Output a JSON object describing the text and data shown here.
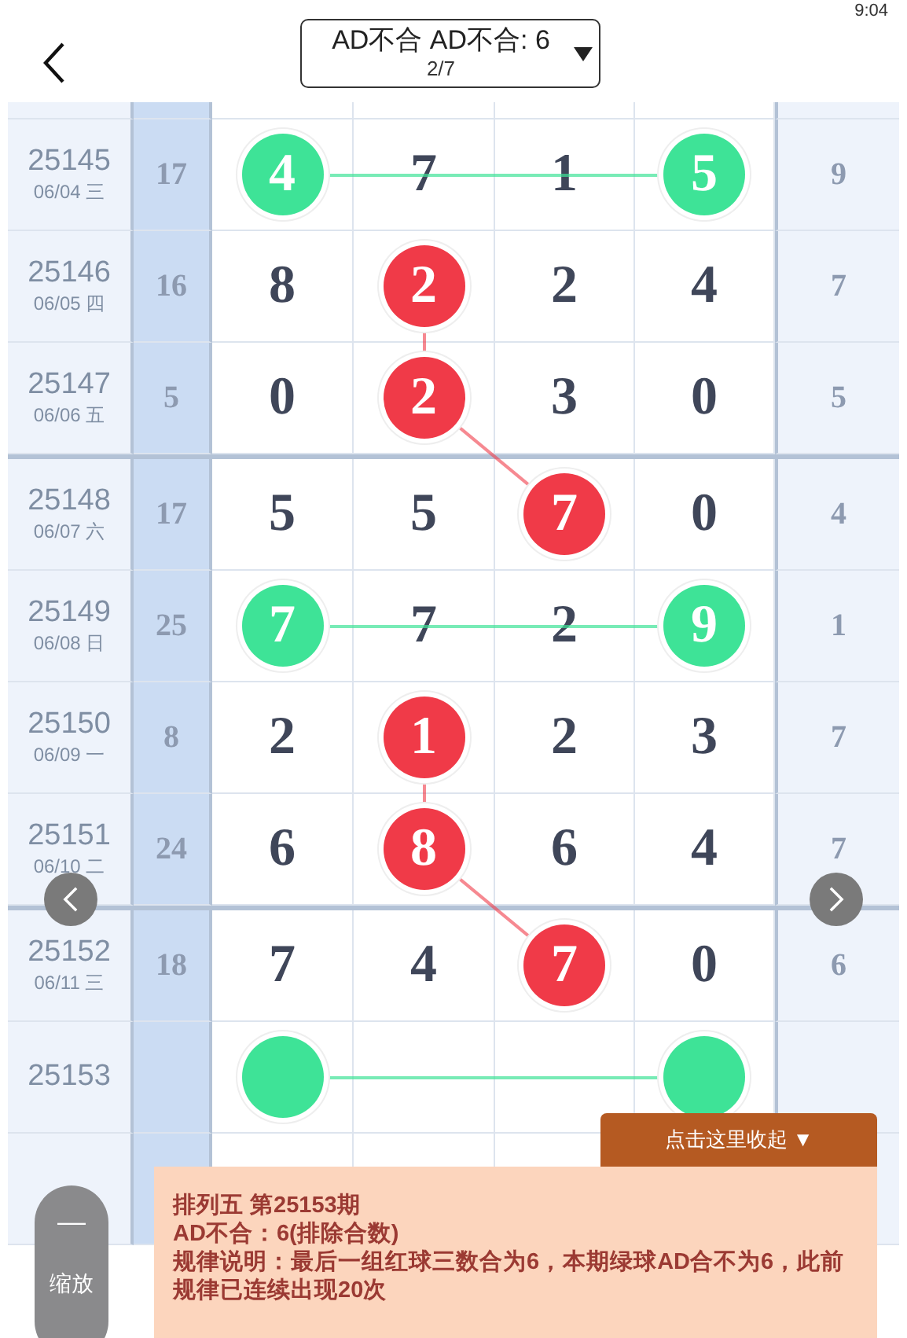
{
  "status_bar": {
    "time": "9:04"
  },
  "header": {
    "title": "AD不合 AD不合: 6",
    "subtitle": "2/7"
  },
  "rows": [
    {
      "issue": "25145",
      "date": "06/04 三",
      "sum": "17",
      "tail": "9",
      "cells": [
        {
          "kind": "ball",
          "value": "4",
          "color": "#3ee397"
        },
        {
          "kind": "digit",
          "value": "7"
        },
        {
          "kind": "digit",
          "value": "1"
        },
        {
          "kind": "ball",
          "value": "5",
          "color": "#3ee397"
        }
      ]
    },
    {
      "issue": "25146",
      "date": "06/05 四",
      "sum": "16",
      "tail": "7",
      "cells": [
        {
          "kind": "digit",
          "value": "8"
        },
        {
          "kind": "ball",
          "value": "2",
          "color": "#f03a48"
        },
        {
          "kind": "digit",
          "value": "2"
        },
        {
          "kind": "digit",
          "value": "4"
        }
      ]
    },
    {
      "issue": "25147",
      "date": "06/06 五",
      "sum": "5",
      "tail": "5",
      "divider_after": true,
      "cells": [
        {
          "kind": "digit",
          "value": "0"
        },
        {
          "kind": "ball",
          "value": "2",
          "color": "#f03a48"
        },
        {
          "kind": "digit",
          "value": "3"
        },
        {
          "kind": "digit",
          "value": "0"
        }
      ]
    },
    {
      "issue": "25148",
      "date": "06/07 六",
      "sum": "17",
      "tail": "4",
      "cells": [
        {
          "kind": "digit",
          "value": "5"
        },
        {
          "kind": "digit",
          "value": "5"
        },
        {
          "kind": "ball",
          "value": "7",
          "color": "#f03a48"
        },
        {
          "kind": "digit",
          "value": "0"
        }
      ]
    },
    {
      "issue": "25149",
      "date": "06/08 日",
      "sum": "25",
      "tail": "1",
      "cells": [
        {
          "kind": "ball",
          "value": "7",
          "color": "#3ee397"
        },
        {
          "kind": "digit",
          "value": "7"
        },
        {
          "kind": "digit",
          "value": "2"
        },
        {
          "kind": "ball",
          "value": "9",
          "color": "#3ee397"
        }
      ]
    },
    {
      "issue": "25150",
      "date": "06/09 一",
      "sum": "8",
      "tail": "7",
      "cells": [
        {
          "kind": "digit",
          "value": "2"
        },
        {
          "kind": "ball",
          "value": "1",
          "color": "#f03a48"
        },
        {
          "kind": "digit",
          "value": "2"
        },
        {
          "kind": "digit",
          "value": "3"
        }
      ]
    },
    {
      "issue": "25151",
      "date": "06/10 二",
      "sum": "24",
      "tail": "7",
      "divider_after": true,
      "cells": [
        {
          "kind": "digit",
          "value": "6"
        },
        {
          "kind": "ball",
          "value": "8",
          "color": "#f03a48"
        },
        {
          "kind": "digit",
          "value": "6"
        },
        {
          "kind": "digit",
          "value": "4"
        }
      ]
    },
    {
      "issue": "25152",
      "date": "06/11 三",
      "sum": "18",
      "tail": "6",
      "cells": [
        {
          "kind": "digit",
          "value": "7"
        },
        {
          "kind": "digit",
          "value": "4"
        },
        {
          "kind": "ball",
          "value": "7",
          "color": "#f03a48"
        },
        {
          "kind": "digit",
          "value": "0"
        }
      ]
    },
    {
      "issue": "25153",
      "cells": [
        {
          "kind": "ball",
          "color": "#3ee397"
        },
        {
          "kind": "digit"
        },
        {
          "kind": "digit"
        },
        {
          "kind": "ball",
          "color": "#3ee397"
        }
      ]
    }
  ],
  "collapse_tab": {
    "label": "点击这里收起 ▼"
  },
  "info_panel": {
    "lines": [
      "排列五 第25153期",
      "AD不合：6(排除合数)",
      "规律说明：最后一组红球三数合为6，本期绿球AD合不为6，此前规律已连续出现20次"
    ]
  },
  "zoom_button": {
    "icon": "—",
    "label": "缩放"
  }
}
